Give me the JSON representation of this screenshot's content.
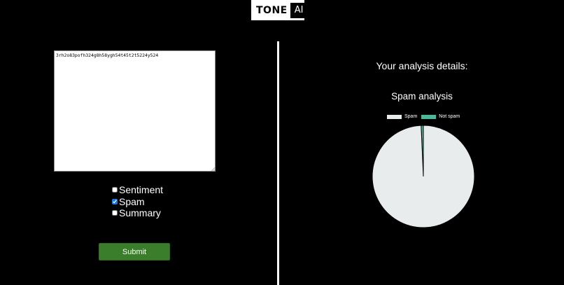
{
  "header": {
    "logo_left": "TONE",
    "logo_right": "AI"
  },
  "input": {
    "text_value": "3rh2o83pofh324g8h58ygh54t45t2t5224y524"
  },
  "options": [
    {
      "label": "Sentiment",
      "checked": false
    },
    {
      "label": "Spam",
      "checked": true
    },
    {
      "label": "Summary",
      "checked": false
    }
  ],
  "submit_label": "Submit",
  "results": {
    "heading": "Your analysis details:"
  },
  "chart_data": {
    "type": "pie",
    "title": "Spam analysis",
    "categories": [
      "Spam",
      "Not spam"
    ],
    "values": [
      99.3,
      0.7
    ],
    "colors": [
      "#e8ecec",
      "#4bb89a"
    ],
    "legend_position": "top"
  },
  "colors": {
    "background": "#000000",
    "submit": "#3a7d2a",
    "checkbox_accent": "#1a73e8"
  }
}
